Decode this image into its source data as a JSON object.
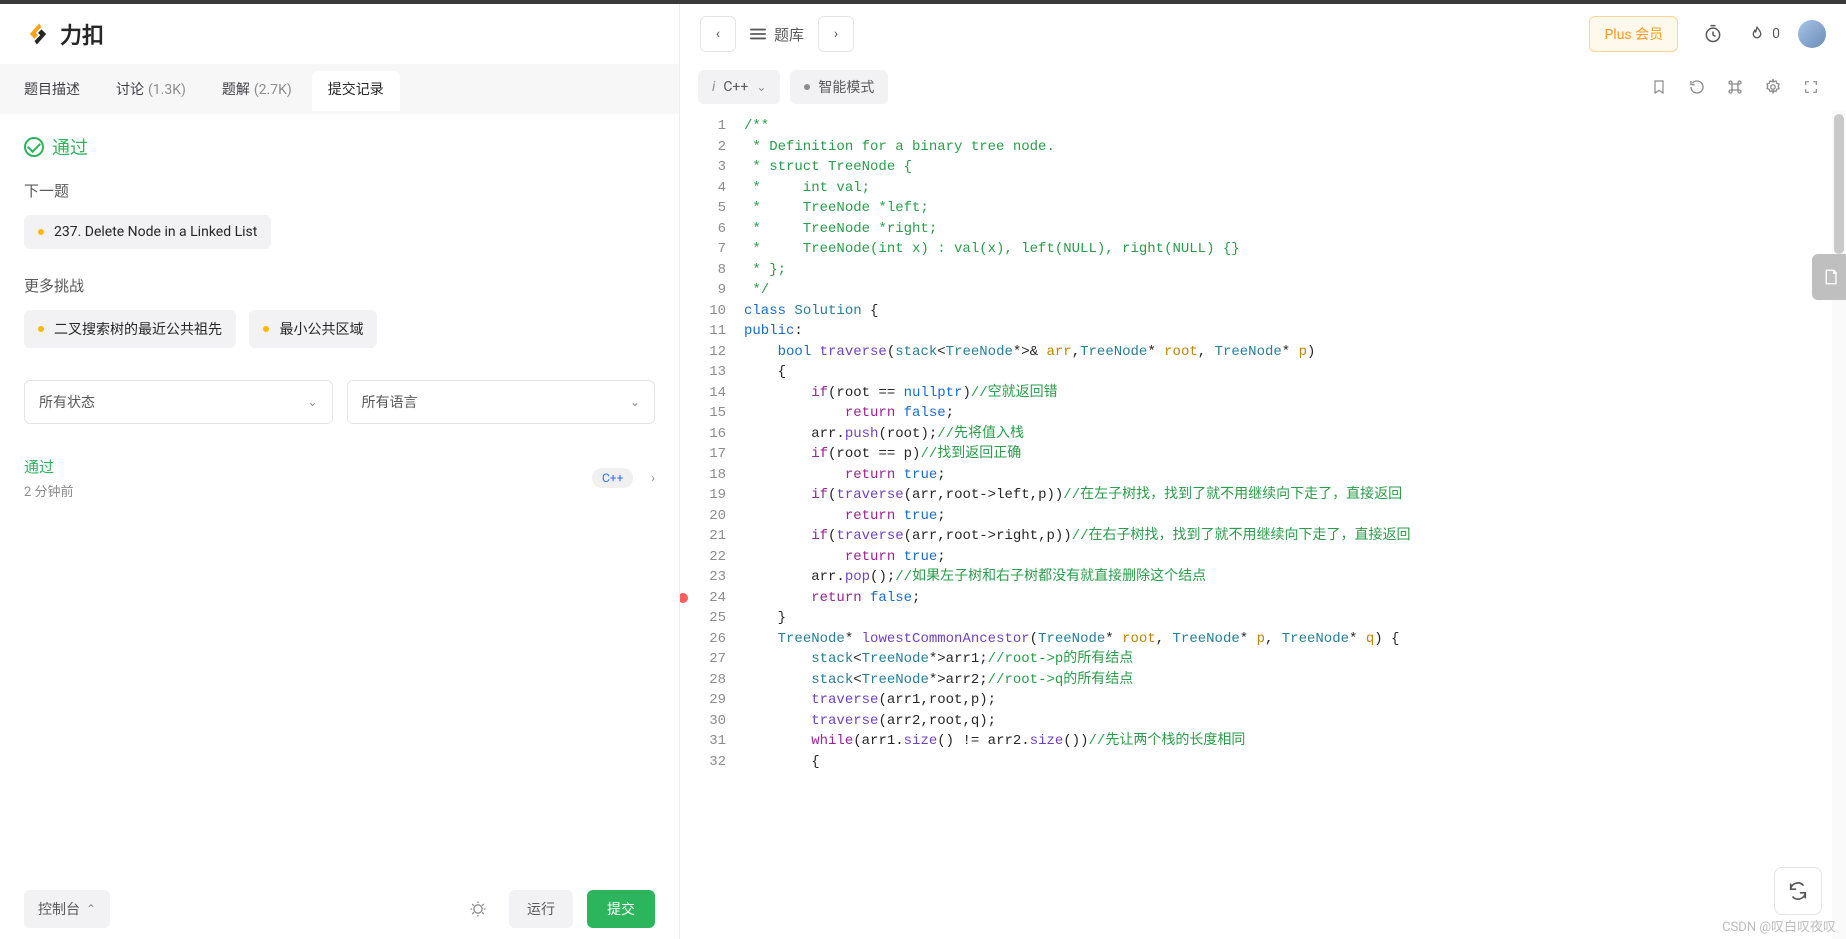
{
  "logo": {
    "text": "力扣"
  },
  "leftTabs": {
    "desc": "题目描述",
    "discuss": "讨论",
    "discuss_count": "(1.3K)",
    "solution": "题解",
    "solution_count": "(2.7K)",
    "submit": "提交记录"
  },
  "status": {
    "label": "通过"
  },
  "next": {
    "title": "下一题",
    "item": "237. Delete Node in a Linked List"
  },
  "more": {
    "title": "更多挑战",
    "items": [
      "二叉搜索树的最近公共祖先",
      "最小公共区域"
    ]
  },
  "filters": {
    "status": "所有状态",
    "lang": "所有语言"
  },
  "submission": {
    "status": "通过",
    "time": "2 分钟前",
    "lang": "C++"
  },
  "leftToolbar": {
    "console": "控制台",
    "run": "运行",
    "submit": "提交"
  },
  "topnav": {
    "lib": "题库",
    "plus": "Plus 会员",
    "flame": "0"
  },
  "codeToolbar": {
    "lang": "C++",
    "mode": "智能模式"
  },
  "code": {
    "lines": [
      [
        {
          "t": "/**",
          "c": "cmt"
        }
      ],
      [
        {
          "t": " * Definition for a binary tree node.",
          "c": "cmt"
        }
      ],
      [
        {
          "t": " * struct TreeNode {",
          "c": "cmt"
        }
      ],
      [
        {
          "t": " *     int val;",
          "c": "cmt"
        }
      ],
      [
        {
          "t": " *     TreeNode *left;",
          "c": "cmt"
        }
      ],
      [
        {
          "t": " *     TreeNode *right;",
          "c": "cmt"
        }
      ],
      [
        {
          "t": " *     TreeNode(int x) : val(x), left(NULL), right(NULL) {}",
          "c": "cmt"
        }
      ],
      [
        {
          "t": " * };",
          "c": "cmt"
        }
      ],
      [
        {
          "t": " */",
          "c": "cmt"
        }
      ],
      [
        {
          "t": "class ",
          "c": "kw2"
        },
        {
          "t": "Solution",
          "c": "tp"
        },
        {
          "t": " {",
          "c": ""
        }
      ],
      [
        {
          "t": "public",
          "c": "kw2"
        },
        {
          "t": ":",
          "c": ""
        }
      ],
      [
        {
          "t": "    ",
          "c": ""
        },
        {
          "t": "bool ",
          "c": "kw2"
        },
        {
          "t": "traverse",
          "c": "fn"
        },
        {
          "t": "(",
          "c": ""
        },
        {
          "t": "stack",
          "c": "tp"
        },
        {
          "t": "<",
          "c": ""
        },
        {
          "t": "TreeNode",
          "c": "tp"
        },
        {
          "t": "*>& ",
          "c": ""
        },
        {
          "t": "arr",
          "c": "pa"
        },
        {
          "t": ",",
          "c": ""
        },
        {
          "t": "TreeNode",
          "c": "tp"
        },
        {
          "t": "* ",
          "c": ""
        },
        {
          "t": "root",
          "c": "pa"
        },
        {
          "t": ", ",
          "c": ""
        },
        {
          "t": "TreeNode",
          "c": "tp"
        },
        {
          "t": "* ",
          "c": ""
        },
        {
          "t": "p",
          "c": "pa"
        },
        {
          "t": ")",
          "c": ""
        }
      ],
      [
        {
          "t": "    {",
          "c": ""
        }
      ],
      [
        {
          "t": "        ",
          "c": ""
        },
        {
          "t": "if",
          "c": "kw"
        },
        {
          "t": "(root == ",
          "c": ""
        },
        {
          "t": "nullptr",
          "c": "kw2"
        },
        {
          "t": ")",
          "c": ""
        },
        {
          "t": "//空就返回错",
          "c": "cmt"
        }
      ],
      [
        {
          "t": "            ",
          "c": ""
        },
        {
          "t": "return ",
          "c": "kw"
        },
        {
          "t": "false",
          "c": "kw2"
        },
        {
          "t": ";",
          "c": ""
        }
      ],
      [
        {
          "t": "        arr.",
          "c": ""
        },
        {
          "t": "push",
          "c": "fn"
        },
        {
          "t": "(root);",
          "c": ""
        },
        {
          "t": "//先将值入栈",
          "c": "cmt"
        }
      ],
      [
        {
          "t": "        ",
          "c": ""
        },
        {
          "t": "if",
          "c": "kw"
        },
        {
          "t": "(root == p)",
          "c": ""
        },
        {
          "t": "//找到返回正确",
          "c": "cmt"
        }
      ],
      [
        {
          "t": "            ",
          "c": ""
        },
        {
          "t": "return ",
          "c": "kw"
        },
        {
          "t": "true",
          "c": "kw2"
        },
        {
          "t": ";",
          "c": ""
        }
      ],
      [
        {
          "t": "        ",
          "c": ""
        },
        {
          "t": "if",
          "c": "kw"
        },
        {
          "t": "(",
          "c": ""
        },
        {
          "t": "traverse",
          "c": "fn"
        },
        {
          "t": "(arr,root->left,p))",
          "c": ""
        },
        {
          "t": "//在左子树找，找到了就不用继续向下走了，直接返回",
          "c": "cmt"
        }
      ],
      [
        {
          "t": "            ",
          "c": ""
        },
        {
          "t": "return ",
          "c": "kw"
        },
        {
          "t": "true",
          "c": "kw2"
        },
        {
          "t": ";",
          "c": ""
        }
      ],
      [
        {
          "t": "        ",
          "c": ""
        },
        {
          "t": "if",
          "c": "kw"
        },
        {
          "t": "(",
          "c": ""
        },
        {
          "t": "traverse",
          "c": "fn"
        },
        {
          "t": "(arr,root->right,p))",
          "c": ""
        },
        {
          "t": "//在右子树找，找到了就不用继续向下走了，直接返回",
          "c": "cmt"
        }
      ],
      [
        {
          "t": "            ",
          "c": ""
        },
        {
          "t": "return ",
          "c": "kw"
        },
        {
          "t": "true",
          "c": "kw2"
        },
        {
          "t": ";",
          "c": ""
        }
      ],
      [
        {
          "t": "        arr.",
          "c": ""
        },
        {
          "t": "pop",
          "c": "fn"
        },
        {
          "t": "();",
          "c": ""
        },
        {
          "t": "//如果左子树和右子树都没有就直接删除这个结点",
          "c": "cmt"
        }
      ],
      [
        {
          "t": "        ",
          "c": ""
        },
        {
          "t": "return ",
          "c": "kw"
        },
        {
          "t": "false",
          "c": "kw2"
        },
        {
          "t": ";",
          "c": ""
        }
      ],
      [
        {
          "t": "    }",
          "c": ""
        }
      ],
      [
        {
          "t": "    ",
          "c": ""
        },
        {
          "t": "TreeNode",
          "c": "tp"
        },
        {
          "t": "* ",
          "c": ""
        },
        {
          "t": "lowestCommonAncestor",
          "c": "fn"
        },
        {
          "t": "(",
          "c": ""
        },
        {
          "t": "TreeNode",
          "c": "tp"
        },
        {
          "t": "* ",
          "c": ""
        },
        {
          "t": "root",
          "c": "pa"
        },
        {
          "t": ", ",
          "c": ""
        },
        {
          "t": "TreeNode",
          "c": "tp"
        },
        {
          "t": "* ",
          "c": ""
        },
        {
          "t": "p",
          "c": "pa"
        },
        {
          "t": ", ",
          "c": ""
        },
        {
          "t": "TreeNode",
          "c": "tp"
        },
        {
          "t": "* ",
          "c": ""
        },
        {
          "t": "q",
          "c": "pa"
        },
        {
          "t": ") {",
          "c": ""
        }
      ],
      [
        {
          "t": "        ",
          "c": ""
        },
        {
          "t": "stack",
          "c": "tp"
        },
        {
          "t": "<",
          "c": ""
        },
        {
          "t": "TreeNode",
          "c": "tp"
        },
        {
          "t": "*>arr1;",
          "c": ""
        },
        {
          "t": "//root->p的所有结点",
          "c": "cmt"
        }
      ],
      [
        {
          "t": "        ",
          "c": ""
        },
        {
          "t": "stack",
          "c": "tp"
        },
        {
          "t": "<",
          "c": ""
        },
        {
          "t": "TreeNode",
          "c": "tp"
        },
        {
          "t": "*>arr2;",
          "c": ""
        },
        {
          "t": "//root->q的所有结点",
          "c": "cmt"
        }
      ],
      [
        {
          "t": "        ",
          "c": ""
        },
        {
          "t": "traverse",
          "c": "fn"
        },
        {
          "t": "(arr1,root,p);",
          "c": ""
        }
      ],
      [
        {
          "t": "        ",
          "c": ""
        },
        {
          "t": "traverse",
          "c": "fn"
        },
        {
          "t": "(arr2,root,q);",
          "c": ""
        }
      ],
      [
        {
          "t": "        ",
          "c": ""
        },
        {
          "t": "while",
          "c": "kw"
        },
        {
          "t": "(arr1.",
          "c": ""
        },
        {
          "t": "size",
          "c": "fn"
        },
        {
          "t": "() != arr2.",
          "c": ""
        },
        {
          "t": "size",
          "c": "fn"
        },
        {
          "t": "())",
          "c": ""
        },
        {
          "t": "//先让两个栈的长度相同",
          "c": "cmt"
        }
      ],
      [
        {
          "t": "        {",
          "c": ""
        }
      ]
    ],
    "breakpoints": [
      24
    ]
  },
  "watermark": "CSDN @叹白叹夜叹"
}
